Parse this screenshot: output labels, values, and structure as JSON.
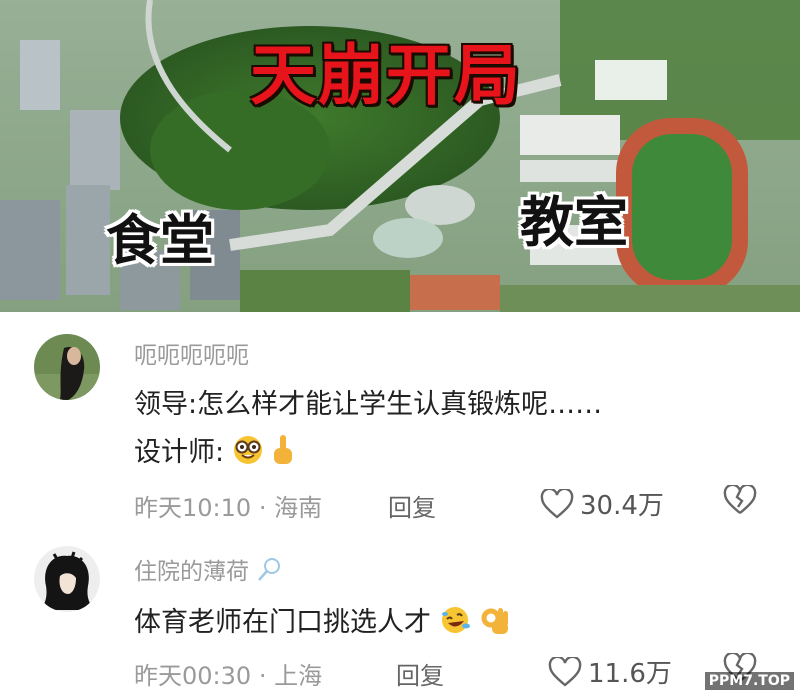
{
  "image": {
    "title": "天崩开局",
    "label_cafeteria": "食堂",
    "label_classroom": "教室"
  },
  "comments": [
    {
      "username": "呃呃呃呃呃",
      "line1": "领导:怎么样才能让学生认真锻炼呢……",
      "line2": "设计师:",
      "emoji": [
        "nerd-face",
        "point-up-hand"
      ],
      "time": "昨天10:10",
      "location": "海南",
      "reply": "回复",
      "likes": "30.4万"
    },
    {
      "username": "住院的薄荷",
      "username_icon": "racket",
      "line1": "体育老师在门口挑选人才",
      "emoji": [
        "rofl-face",
        "ok-hand"
      ],
      "time": "昨天00:30",
      "location": "上海",
      "reply": "回复",
      "likes": "11.6万"
    }
  ],
  "meta_separator": "·",
  "watermark": "PPM7.TOP",
  "colors": {
    "title_red": "#e8141c",
    "gray_text": "#9a9a9a"
  }
}
